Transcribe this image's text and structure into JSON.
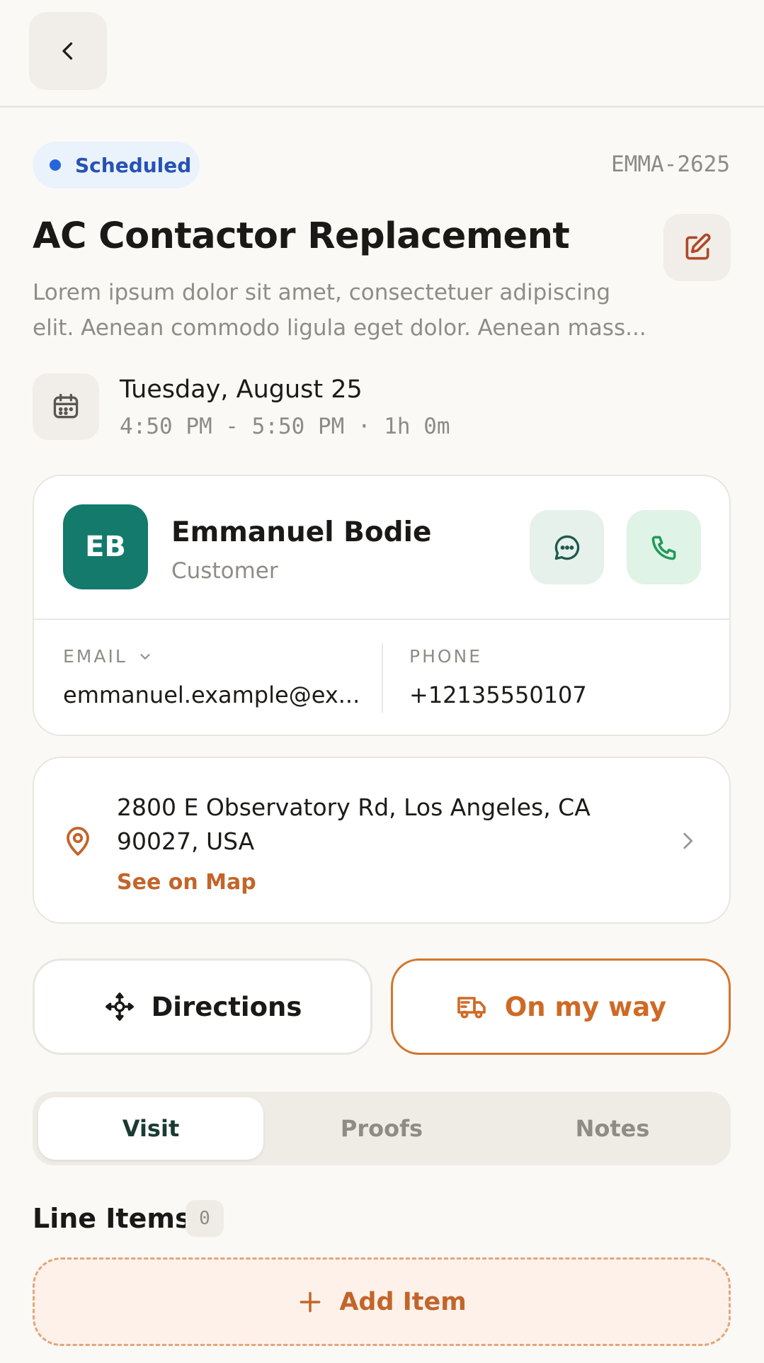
{
  "header": {
    "back_icon": "chevron-left-icon"
  },
  "job": {
    "status": "Scheduled",
    "status_color": "#2864dc",
    "reference": "EMMA-2625",
    "title": "AC Contactor Replacement",
    "description": "Lorem ipsum dolor sit amet, consectetuer adipiscing elit. Aenean commodo ligula eget dolor. Aenean mass...",
    "edit_icon": "edit-icon"
  },
  "schedule": {
    "date": "Tuesday, August 25",
    "time": "4:50 PM - 5:50 PM · 1h 0m",
    "icon": "calendar-icon"
  },
  "customer": {
    "initials": "EB",
    "name": "Emmanuel Bodie",
    "role": "Customer",
    "avatar_color": "#137a6c",
    "email_label": "EMAIL",
    "email": "emmanuel.example@ex...",
    "phone_label": "PHONE",
    "phone": "+12135550107"
  },
  "address": {
    "line": "2800 E Observatory Rd, Los Angeles, CA 90027, USA",
    "map_link": "See on Map"
  },
  "actions": {
    "directions": "Directions",
    "on_my_way": "On my way",
    "accent_color": "#d4762d"
  },
  "tabs": [
    {
      "label": "Visit",
      "active": true
    },
    {
      "label": "Proofs",
      "active": false
    },
    {
      "label": "Notes",
      "active": false
    }
  ],
  "line_items": {
    "title": "Line Items",
    "count": "0",
    "add_label": "Add Item"
  }
}
